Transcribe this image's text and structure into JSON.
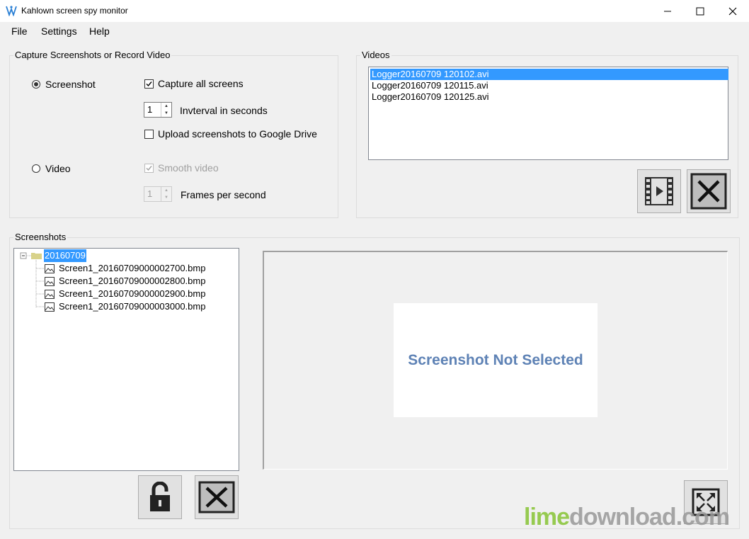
{
  "window": {
    "title": "Kahlown screen spy monitor"
  },
  "menu": [
    "File",
    "Settings",
    "Help"
  ],
  "capture": {
    "group_label": "Capture Screenshots or Record Video",
    "screenshot_label": "Screenshot",
    "screenshot_selected": true,
    "capture_all_label": "Capture all screens",
    "capture_all_checked": true,
    "interval_value": "1",
    "interval_label": "Invterval in seconds",
    "upload_label": "Upload screenshots to Google Drive",
    "upload_checked": false,
    "video_label": "Video",
    "video_selected": false,
    "smooth_label": "Smooth video",
    "smooth_checked": true,
    "fps_value": "1",
    "fps_label": "Frames per second"
  },
  "videos": {
    "group_label": "Videos",
    "items": [
      "Logger20160709 120102.avi",
      "Logger20160709 120115.avi",
      "Logger20160709 120125.avi"
    ],
    "selected_index": 0
  },
  "screenshots": {
    "group_label": "Screenshots",
    "folder": "20160709",
    "files": [
      "Screen1_20160709000002700.bmp",
      "Screen1_20160709000002800.bmp",
      "Screen1_20160709000002900.bmp",
      "Screen1_20160709000003000.bmp"
    ],
    "preview_text": "Screenshot Not Selected"
  },
  "watermark": {
    "part1": "lime",
    "part2": "download.com",
    "color1": "#8dc63f",
    "color2": "#999999"
  },
  "colors": {
    "selection": "#3399ff",
    "preview_text": "#5e82b5"
  }
}
